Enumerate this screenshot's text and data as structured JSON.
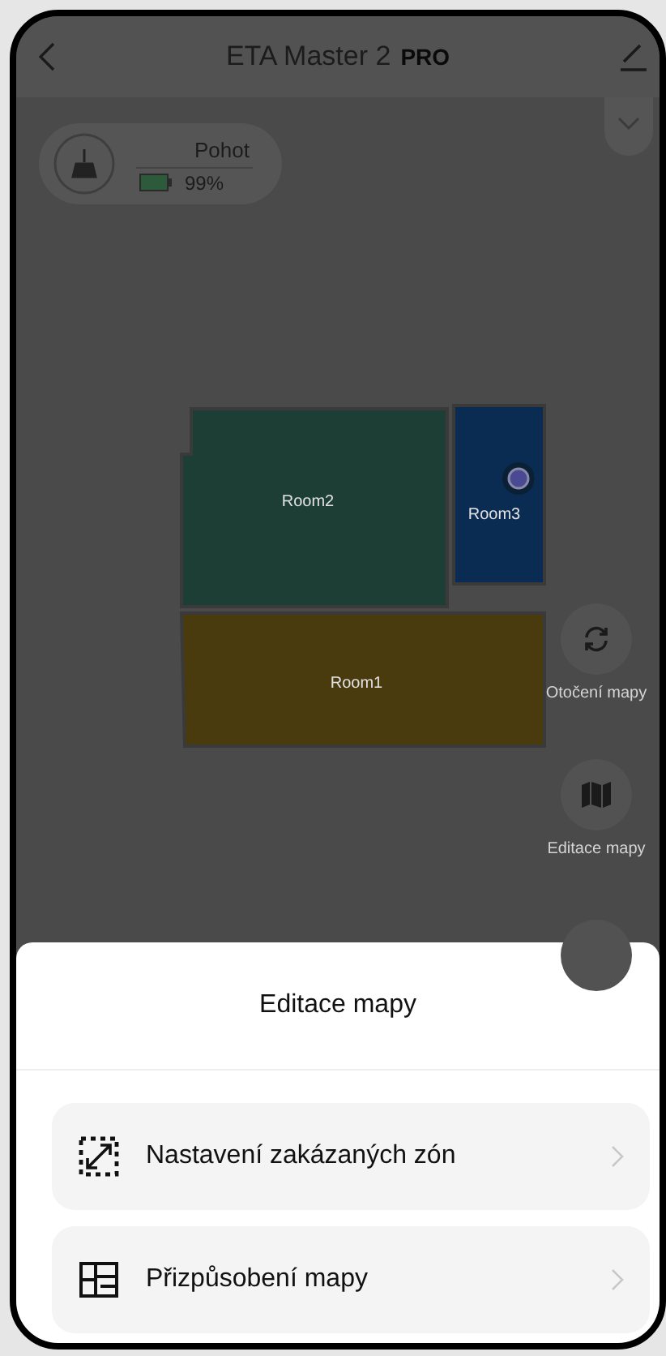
{
  "header": {
    "title": "ETA Master 2",
    "badge": "PRO"
  },
  "status": {
    "mode": "Pohot",
    "battery": "99%"
  },
  "map": {
    "rooms": [
      {
        "name": "Room2",
        "color": "#1d3e34"
      },
      {
        "name": "Room3",
        "color": "#0b2c52"
      },
      {
        "name": "Room1",
        "color": "#4a3b0f"
      }
    ]
  },
  "map_tools": [
    {
      "kind": "rotate",
      "label": "Otočení mapy"
    },
    {
      "kind": "map",
      "label": "Editace mapy"
    }
  ],
  "sheet": {
    "title": "Editace mapy",
    "items": [
      {
        "kind": "zone",
        "label": "Nastavení zakázaných zón"
      },
      {
        "kind": "layout",
        "label": "Přizpůsobení mapy"
      }
    ]
  }
}
